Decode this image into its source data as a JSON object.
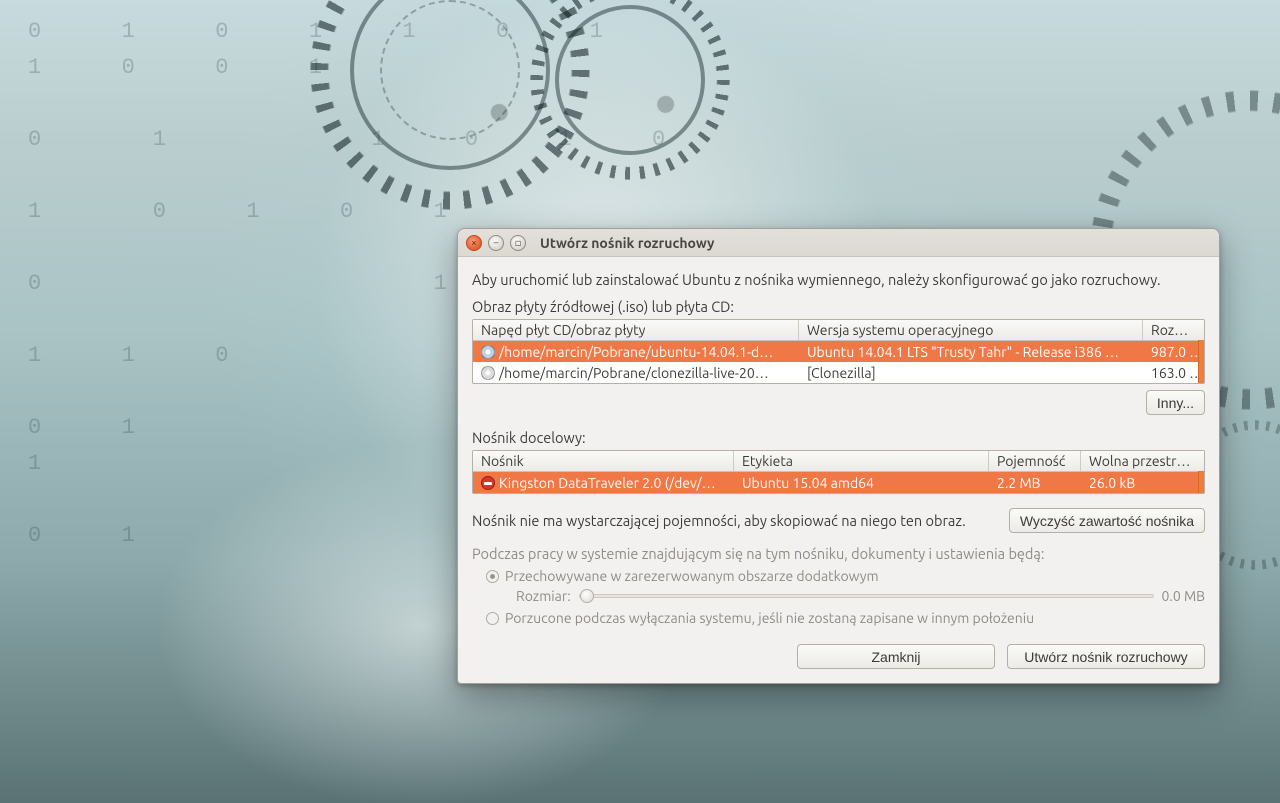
{
  "window": {
    "title": "Utwórz nośnik rozruchowy",
    "intro": "Aby uruchomić lub zainstalować Ubuntu z nośnika wymiennego, należy skonfigurować go jako rozruchowy.",
    "source_label": "Obraz płyty źródłowej (.iso) lub płyta CD:",
    "source_headers": {
      "drive": "Napęd płyt CD/obraz płyty",
      "os": "Wersja systemu operacyjnego",
      "size": "Rozmiar"
    },
    "source_rows": [
      {
        "path": "/home/marcin/Pobrane/ubuntu-14.04.1-d…",
        "os": "Ubuntu 14.04.1 LTS \"Trusty Tahr\" - Release i386 …",
        "size": "987.0 …",
        "selected": true
      },
      {
        "path": "/home/marcin/Pobrane/clonezilla-live-20…",
        "os": "[Clonezilla]",
        "size": "163.0 …",
        "selected": false
      }
    ],
    "other_button": "Inny...",
    "target_label": "Nośnik docelowy:",
    "target_headers": {
      "device": "Nośnik",
      "label": "Etykieta",
      "capacity": "Pojemność",
      "free": "Wolna przestrzeń"
    },
    "target_rows": [
      {
        "device": "Kingston DataTraveler 2.0 (/dev/…",
        "label": "Ubuntu 15.04 amd64",
        "capacity": "2.2 MB",
        "free": "26.0 kB",
        "selected": true,
        "error": true
      }
    ],
    "warning_text": "Nośnik nie ma wystarczającej pojemności, aby skopiować na niego ten obraz.",
    "erase_button": "Wyczyść zawartość nośnika",
    "persist_intro": "Podczas pracy w systemie znajdującym się na tym nośniku, dokumenty i ustawienia będą:",
    "persist_option_a": "Przechowywane w zarezerwowanym obszarze dodatkowym",
    "persist_size_label": "Rozmiar:",
    "persist_size_value": "0.0 MB",
    "persist_option_b": "Porzucone podczas wyłączania systemu, jeśli nie zostaną zapisane w innym położeniu",
    "close_button": "Zamknij",
    "create_button": "Utwórz nośnik rozruchowy"
  }
}
